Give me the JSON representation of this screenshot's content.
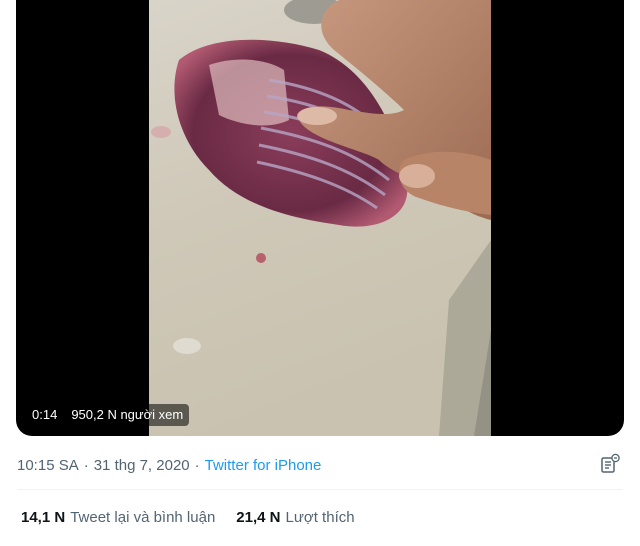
{
  "video": {
    "duration": "0:14",
    "views": "950,2 N người xem"
  },
  "tweet_meta": {
    "time": "10:15 SA",
    "separator": "·",
    "date": "31 thg 7, 2020",
    "source": "Twitter for iPhone"
  },
  "stats": {
    "retweets": {
      "count": "14,1 N",
      "label": "Tweet lại và bình luận"
    },
    "likes": {
      "count": "21,4 N",
      "label": "Lượt thích"
    }
  },
  "icons": {
    "analytics": "analytics-icon"
  },
  "colors": {
    "link": "#1d9bf0",
    "secondary_text": "#536471",
    "primary_text": "#0f1419",
    "divider": "#eff3f4"
  }
}
